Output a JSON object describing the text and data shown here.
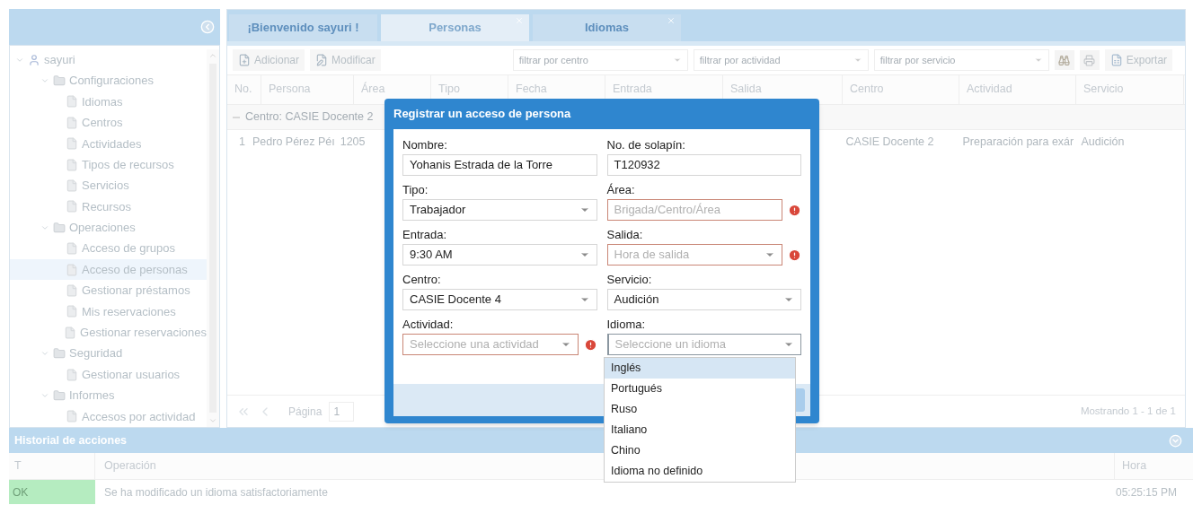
{
  "sidebar": {
    "tree": [
      {
        "label": "sayuri",
        "kind": "user",
        "expanded": true,
        "selected": false,
        "children": [
          {
            "label": "Configuraciones",
            "kind": "folder",
            "expanded": true,
            "selected": false,
            "children": [
              {
                "label": "Idiomas",
                "kind": "page",
                "selected": false
              },
              {
                "label": "Centros",
                "kind": "page",
                "selected": false
              },
              {
                "label": "Actividades",
                "kind": "page",
                "selected": false
              },
              {
                "label": "Tipos de recursos",
                "kind": "page",
                "selected": false
              },
              {
                "label": "Servicios",
                "kind": "page",
                "selected": false
              },
              {
                "label": "Recursos",
                "kind": "page",
                "selected": false
              }
            ]
          },
          {
            "label": "Operaciones",
            "kind": "folder",
            "expanded": true,
            "selected": false,
            "children": [
              {
                "label": "Acceso de grupos",
                "kind": "page",
                "selected": false
              },
              {
                "label": "Acceso de personas",
                "kind": "page",
                "selected": true
              },
              {
                "label": "Gestionar préstamos",
                "kind": "page",
                "selected": false
              },
              {
                "label": "Mis reservaciones",
                "kind": "page",
                "selected": false
              },
              {
                "label": "Gestionar reservaciones",
                "kind": "page",
                "selected": false
              }
            ]
          },
          {
            "label": "Seguridad",
            "kind": "folder",
            "expanded": true,
            "selected": false,
            "children": [
              {
                "label": "Gestionar usuarios",
                "kind": "page",
                "selected": false
              }
            ]
          },
          {
            "label": "Informes",
            "kind": "folder",
            "expanded": true,
            "selected": false,
            "children": [
              {
                "label": "Accesos por actividad",
                "kind": "page",
                "selected": false
              }
            ]
          }
        ]
      }
    ]
  },
  "tabs": [
    {
      "label": "¡Bienvenido sayuri !",
      "selected": false,
      "closable": false
    },
    {
      "label": "Personas",
      "selected": true,
      "closable": true
    },
    {
      "label": "Idiomas",
      "selected": false,
      "closable": true
    }
  ],
  "toolbar": {
    "buttons": [
      {
        "label": "Adicionar"
      },
      {
        "label": "Modificar"
      }
    ],
    "filters": [
      {
        "placeholder": "filtrar por centro"
      },
      {
        "placeholder": "filtrar por actividad"
      },
      {
        "placeholder": "filtrar por servicio"
      }
    ],
    "export": "Exportar"
  },
  "table": {
    "columns": [
      "No.",
      "Persona",
      "Área",
      "Tipo",
      "Fecha",
      "Entrada",
      "Salida",
      "Centro",
      "Actividad",
      "Servicio"
    ],
    "group": "Centro: CASIE Docente 2",
    "rows": [
      {
        "no": "1",
        "persona": "Pedro Pérez Péı",
        "area": "1205",
        "centro": "CASIE Docente 2",
        "actividad": "Preparación para exár",
        "servicio": "Audición"
      }
    ]
  },
  "pager": {
    "label": "Página",
    "page": "1",
    "summary": "Mostrando 1 - 1 de 1"
  },
  "history": {
    "title": "Historial de acciones",
    "columns": [
      "T",
      "Operación",
      "Hora"
    ],
    "rows": [
      {
        "status": "OK",
        "operation": "Se ha modificado un idioma satisfactoriamente",
        "time": "05:25:15 PM"
      }
    ]
  },
  "dialog": {
    "title": "Registrar un acceso de persona",
    "fields": [
      {
        "label": "Nombre:",
        "kind": "text",
        "value": "Yohanis Estrada de la Torre",
        "invalid": false,
        "focused": false
      },
      {
        "label": "No. de solapín:",
        "kind": "text",
        "value": "T120932",
        "invalid": false,
        "focused": false
      },
      {
        "label": "Tipo:",
        "kind": "combo",
        "value": "Trabajador",
        "invalid": false,
        "focused": false
      },
      {
        "label": "Área:",
        "kind": "text",
        "placeholder": "Brigada/Centro/Área",
        "invalid": true,
        "focused": false
      },
      {
        "label": "Entrada:",
        "kind": "combo",
        "value": "9:30 AM",
        "invalid": false,
        "focused": false
      },
      {
        "label": "Salida:",
        "kind": "combo",
        "placeholder": "Hora de salida",
        "invalid": true,
        "focused": false
      },
      {
        "label": "Centro:",
        "kind": "combo",
        "value": "CASIE Docente 4",
        "invalid": false,
        "focused": false
      },
      {
        "label": "Servicio:",
        "kind": "combo",
        "value": "Audición",
        "invalid": false,
        "focused": false
      },
      {
        "label": "Actividad:",
        "kind": "combo",
        "placeholder": "Seleccione una actividad",
        "invalid": true,
        "focused": false
      },
      {
        "label": "Idioma:",
        "kind": "combo",
        "placeholder": "Seleccione un idioma",
        "invalid": false,
        "focused": true
      }
    ],
    "options": [
      {
        "label": "Inglés",
        "selected": true
      },
      {
        "label": "Portugués",
        "selected": false
      },
      {
        "label": "Ruso",
        "selected": false
      },
      {
        "label": "Italiano",
        "selected": false
      },
      {
        "label": "Chino",
        "selected": false
      },
      {
        "label": "Idioma no definido",
        "selected": false
      }
    ]
  }
}
